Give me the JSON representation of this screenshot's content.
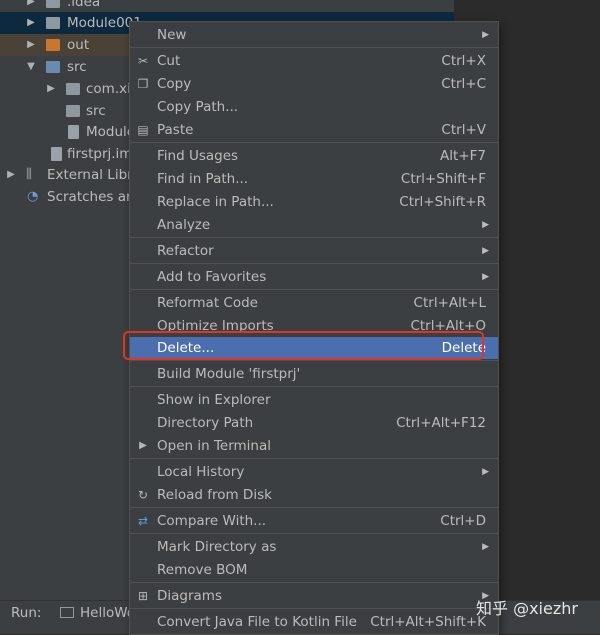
{
  "project_tree": {
    "rows": [
      {
        "label": ".idea"
      },
      {
        "label": "Module001"
      },
      {
        "label": "out"
      },
      {
        "label": "src"
      },
      {
        "label": "com.xie"
      },
      {
        "label": "src"
      },
      {
        "label": "Module"
      },
      {
        "label": "firstprj.iml"
      },
      {
        "label": "External Libra"
      },
      {
        "label": "Scratches and"
      }
    ]
  },
  "context_menu": {
    "items": [
      {
        "label": "New",
        "shortcut": "",
        "has_submenu": true,
        "icon": ""
      },
      {
        "label": "Cut",
        "shortcut": "Ctrl+X",
        "icon": "scissors-icon",
        "icon_glyph": "✂"
      },
      {
        "label": "Copy",
        "shortcut": "Ctrl+C",
        "icon": "copy-icon",
        "icon_glyph": "❐"
      },
      {
        "label": "Copy Path...",
        "shortcut": "",
        "icon": ""
      },
      {
        "label": "Paste",
        "shortcut": "Ctrl+V",
        "icon": "paste-icon",
        "icon_glyph": "▤"
      },
      {
        "label": "Find Usages",
        "shortcut": "Alt+F7",
        "icon": ""
      },
      {
        "label": "Find in Path...",
        "shortcut": "Ctrl+Shift+F",
        "icon": ""
      },
      {
        "label": "Replace in Path...",
        "shortcut": "Ctrl+Shift+R",
        "icon": ""
      },
      {
        "label": "Analyze",
        "shortcut": "",
        "has_submenu": true,
        "icon": ""
      },
      {
        "label": "Refactor",
        "shortcut": "",
        "has_submenu": true,
        "icon": ""
      },
      {
        "label": "Add to Favorites",
        "shortcut": "",
        "has_submenu": true,
        "icon": ""
      },
      {
        "label": "Reformat Code",
        "shortcut": "Ctrl+Alt+L",
        "icon": ""
      },
      {
        "label": "Optimize Imports",
        "shortcut": "Ctrl+Alt+O",
        "icon": ""
      },
      {
        "label": "Delete...",
        "shortcut": "Delete",
        "highlighted": true,
        "icon": ""
      },
      {
        "label": "Build Module 'firstprj'",
        "shortcut": "",
        "icon": ""
      },
      {
        "label": "Show in Explorer",
        "shortcut": "",
        "icon": ""
      },
      {
        "label": "Directory Path",
        "shortcut": "Ctrl+Alt+F12",
        "icon": ""
      },
      {
        "label": "Open in Terminal",
        "shortcut": "",
        "icon": "terminal-icon",
        "icon_glyph": "▶"
      },
      {
        "label": "Local History",
        "shortcut": "",
        "has_submenu": true,
        "icon": ""
      },
      {
        "label": "Reload from Disk",
        "shortcut": "",
        "icon": "reload-icon",
        "icon_glyph": "↻"
      },
      {
        "label": "Compare With...",
        "shortcut": "Ctrl+D",
        "icon": "compare-icon",
        "icon_glyph": "⇄"
      },
      {
        "label": "Mark Directory as",
        "shortcut": "",
        "has_submenu": true,
        "icon": ""
      },
      {
        "label": "Remove BOM",
        "shortcut": "",
        "icon": ""
      },
      {
        "label": "Diagrams",
        "shortcut": "",
        "has_submenu": true,
        "icon": "diagram-icon",
        "icon_glyph": "⊞"
      },
      {
        "label": "Convert Java File to Kotlin File",
        "shortcut": "Ctrl+Alt+Shift+K",
        "icon": ""
      }
    ]
  },
  "run_bar": {
    "label": "Run:",
    "tab": "HelloWor"
  },
  "watermark": "知乎 @xiezhr",
  "colors": {
    "menu_bg": "#3c3f41",
    "highlight": "#4b6eaf",
    "annotation_red": "#e0342a",
    "folder_orange": "#c9772f"
  }
}
